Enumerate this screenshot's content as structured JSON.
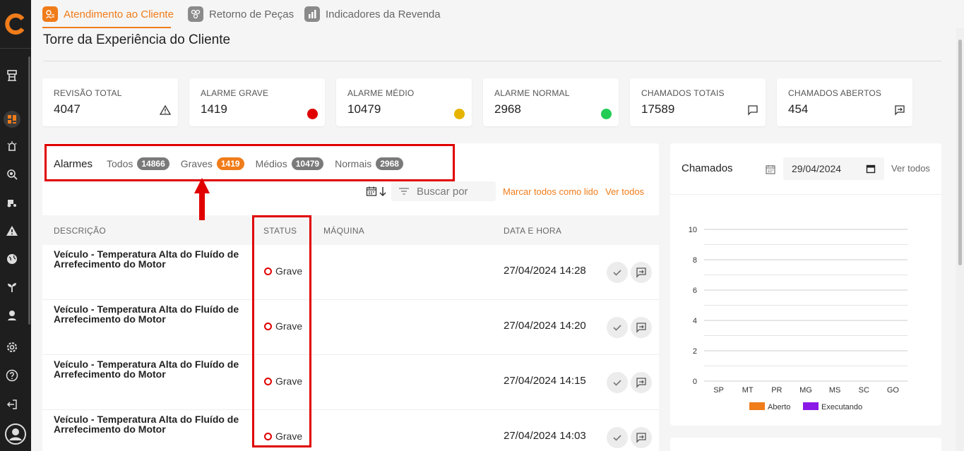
{
  "tabs": [
    {
      "label": "Atendimento ao Cliente",
      "active": true
    },
    {
      "label": "Retorno de Peças",
      "active": false
    },
    {
      "label": "Indicadores da Revenda",
      "active": false
    }
  ],
  "page": {
    "title": "Torre da Experiência do Cliente"
  },
  "kpis": [
    {
      "label": "REVISÃO TOTAL",
      "value": "4047",
      "indicator": "warning-icon"
    },
    {
      "label": "ALARME GRAVE",
      "value": "1419",
      "indicator": "red-dot",
      "color": "#e00000"
    },
    {
      "label": "ALARME MÉDIO",
      "value": "10479",
      "indicator": "yellow-dot",
      "color": "#e6b400"
    },
    {
      "label": "ALARME NORMAL",
      "value": "2968",
      "indicator": "green-dot",
      "color": "#22cc55"
    },
    {
      "label": "CHAMADOS TOTAIS",
      "value": "17589",
      "indicator": "chat-icon"
    },
    {
      "label": "CHAMADOS ABERTOS",
      "value": "454",
      "indicator": "forward-message-icon"
    }
  ],
  "alarms": {
    "title": "Alarmes",
    "filters": [
      {
        "label": "Todos",
        "count": "14866"
      },
      {
        "label": "Graves",
        "count": "1419"
      },
      {
        "label": "Médios",
        "count": "10479"
      },
      {
        "label": "Normais",
        "count": "2968"
      }
    ],
    "search_placeholder": "Buscar por",
    "mark_all": "Marcar todos como lido",
    "see_all": "Ver todos",
    "columns": [
      "DESCRIÇÃO",
      "STATUS",
      "MÁQUINA",
      "DATA E HORA"
    ],
    "rows": [
      {
        "description": "Veículo - Temperatura Alta do Fluído de Arrefecimento do Motor",
        "status": "Grave",
        "machine": "",
        "datetime": "27/04/2024 14:28"
      },
      {
        "description": "Veículo - Temperatura Alta do Fluído de Arrefecimento do Motor",
        "status": "Grave",
        "machine": "",
        "datetime": "27/04/2024 14:20"
      },
      {
        "description": "Veículo - Temperatura Alta do Fluído de Arrefecimento do Motor",
        "status": "Grave",
        "machine": "",
        "datetime": "27/04/2024 14:15"
      },
      {
        "description": "Veículo - Temperatura Alta do Fluído de Arrefecimento do Motor",
        "status": "Grave",
        "machine": "",
        "datetime": "27/04/2024 14:03"
      }
    ]
  },
  "calls": {
    "title": "Chamados",
    "date": "29/04/2024",
    "see_all": "Ver todos"
  },
  "chart_data": {
    "type": "bar",
    "categories": [
      "SP",
      "MT",
      "PR",
      "MG",
      "MS",
      "SC",
      "GO"
    ],
    "series": [
      {
        "name": "Aberto",
        "color": "#f07c1a",
        "values": [
          0,
          0,
          0,
          0,
          0,
          0,
          0
        ]
      },
      {
        "name": "Executando",
        "color": "#8a18e6",
        "values": [
          0,
          0,
          0,
          0,
          0,
          0,
          0
        ]
      }
    ],
    "yticks": [
      0,
      2,
      4,
      6,
      8,
      10
    ],
    "ylim": [
      0,
      10
    ],
    "legend": "bottom",
    "grid": true
  }
}
